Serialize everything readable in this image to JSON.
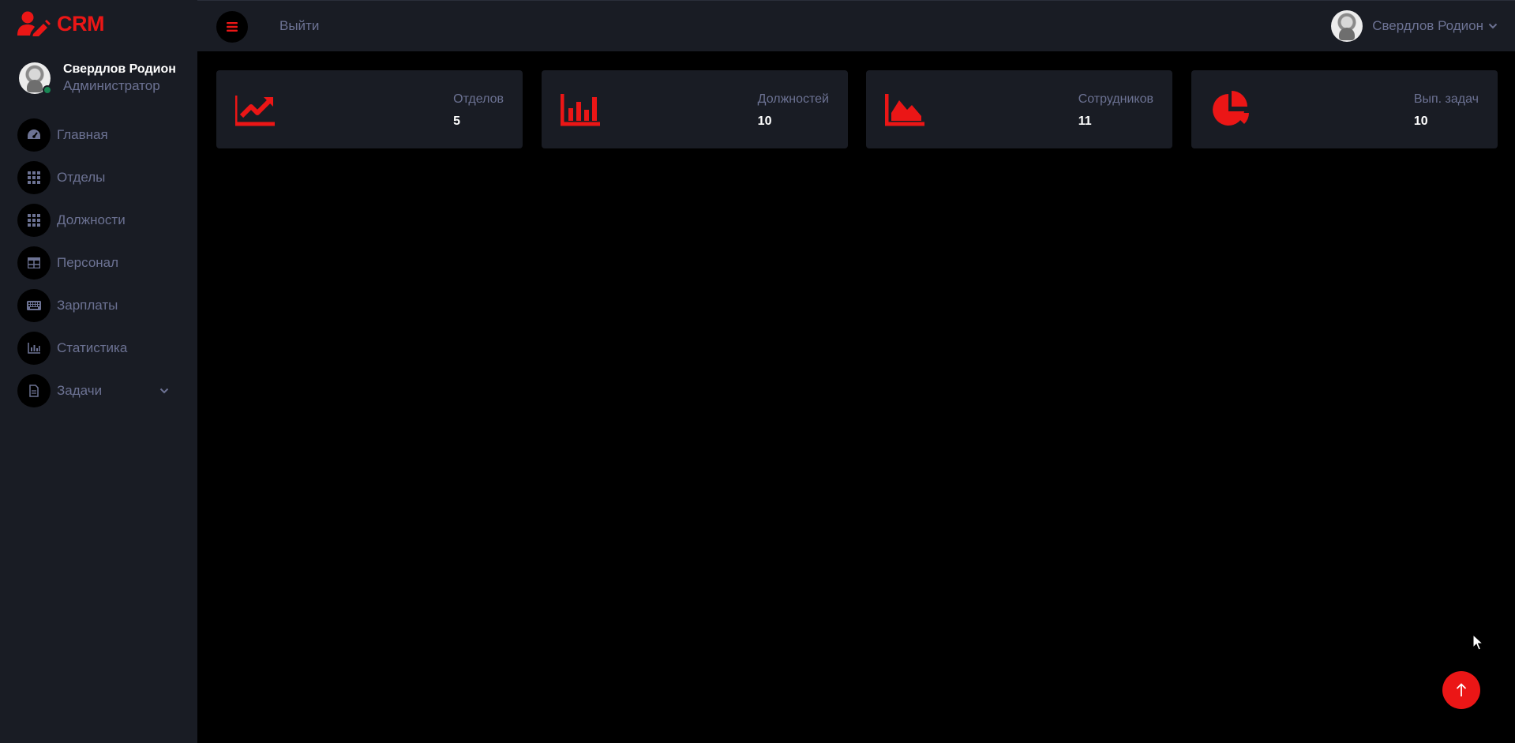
{
  "brand": {
    "name": "CRM"
  },
  "sidebar": {
    "user": {
      "name": "Свердлов Родион",
      "role": "Администратор"
    },
    "items": [
      {
        "label": "Главная",
        "icon": "tachometer-icon"
      },
      {
        "label": "Отделы",
        "icon": "grid-icon"
      },
      {
        "label": "Должности",
        "icon": "grid-icon"
      },
      {
        "label": "Персонал",
        "icon": "table-icon"
      },
      {
        "label": "Зарплаты",
        "icon": "keyboard-icon"
      },
      {
        "label": "Статистика",
        "icon": "chart-bar-icon"
      },
      {
        "label": "Задачи",
        "icon": "file-icon"
      }
    ]
  },
  "topbar": {
    "logout_label": "Выйти",
    "user_name": "Свердлов Родион"
  },
  "cards": [
    {
      "label": "Отделов",
      "value": "5",
      "icon": "chart-line-icon"
    },
    {
      "label": "Должностей",
      "value": "10",
      "icon": "chart-bar-icon"
    },
    {
      "label": "Сотрудников",
      "value": "11",
      "icon": "chart-area-icon"
    },
    {
      "label": "Вып. задач",
      "value": "10",
      "icon": "chart-pie-icon"
    }
  ],
  "colors": {
    "accent": "#eb1616",
    "panel": "#191c24",
    "muted": "#6c7293",
    "background": "#000000"
  }
}
